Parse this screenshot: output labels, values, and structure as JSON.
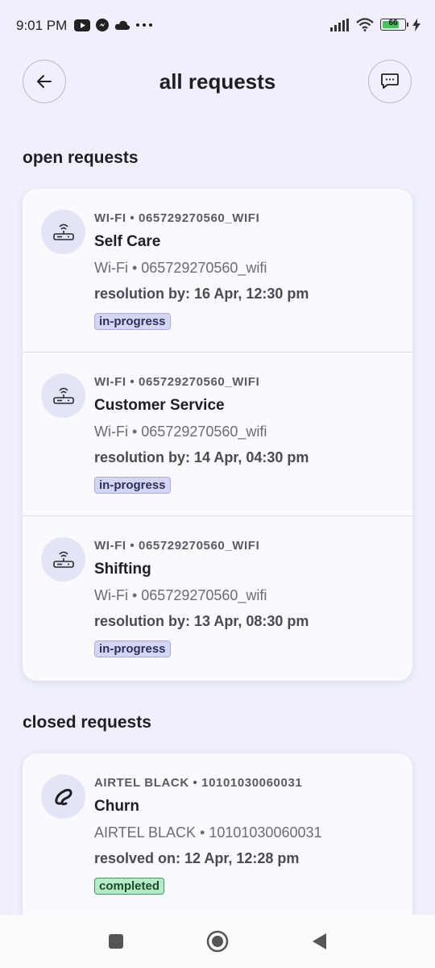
{
  "status_bar": {
    "time": "9:01 PM",
    "left_icons": [
      "youtube-icon",
      "messenger-icon",
      "cloud-icon",
      "more-dots-icon"
    ],
    "right_icons": [
      "signal-icon",
      "wifi-icon",
      "battery-icon",
      "charging-icon"
    ],
    "battery_level": "66"
  },
  "header": {
    "title": "all requests",
    "back_icon": "arrow-left-icon",
    "chat_icon": "chat-icon"
  },
  "open_section": {
    "title": "open requests",
    "items": [
      {
        "meta": "WI-FI • 065729270560_WIFI",
        "name": "Self Care",
        "sub": "Wi-Fi • 065729270560_wifi",
        "resolution": "resolution by: 16 Apr, 12:30 pm",
        "status": "in-progress",
        "icon": "router-icon"
      },
      {
        "meta": "WI-FI • 065729270560_WIFI",
        "name": "Customer Service",
        "sub": "Wi-Fi • 065729270560_wifi",
        "resolution": "resolution by: 14 Apr, 04:30 pm",
        "status": "in-progress",
        "icon": "router-icon"
      },
      {
        "meta": "WI-FI • 065729270560_WIFI",
        "name": "Shifting",
        "sub": "Wi-Fi • 065729270560_wifi",
        "resolution": "resolution by: 13 Apr, 08:30 pm",
        "status": "in-progress",
        "icon": "router-icon"
      }
    ]
  },
  "closed_section": {
    "title": "closed requests",
    "items": [
      {
        "meta": "AIRTEL BLACK • 10101030060031",
        "name": "Churn",
        "sub": "AIRTEL BLACK • 10101030060031",
        "resolution": "resolved on: 12 Apr, 12:28 pm",
        "status": "completed",
        "icon": "airtel-logo-icon"
      }
    ]
  },
  "nav_bar": {
    "items": [
      "recents-square-icon",
      "home-circle-icon",
      "back-triangle-icon"
    ]
  },
  "colors": {
    "background": "#eff0fb",
    "card": "#f9f9ff",
    "badge_progress": "#d4d6f5",
    "badge_completed": "#b7eac8",
    "battery_fill": "#43c35a"
  }
}
